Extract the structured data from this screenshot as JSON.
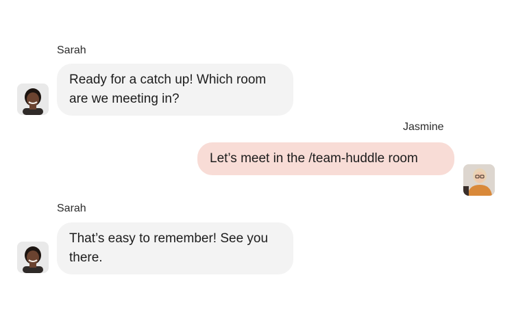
{
  "messages": [
    {
      "sender": "Sarah",
      "text": "Ready for a catch up! Which room are we meeting in?",
      "avatar_icon": "sarah-avatar",
      "bubble_color": "#f3f3f3"
    },
    {
      "sender": "Jasmine",
      "text": "Let’s meet in the /team-huddle room",
      "avatar_icon": "jasmine-avatar",
      "bubble_color": "#f8dcd6"
    },
    {
      "sender": "Sarah",
      "text": "That’s easy to remember! See you there.",
      "avatar_icon": "sarah-avatar",
      "bubble_color": "#f3f3f3"
    }
  ]
}
